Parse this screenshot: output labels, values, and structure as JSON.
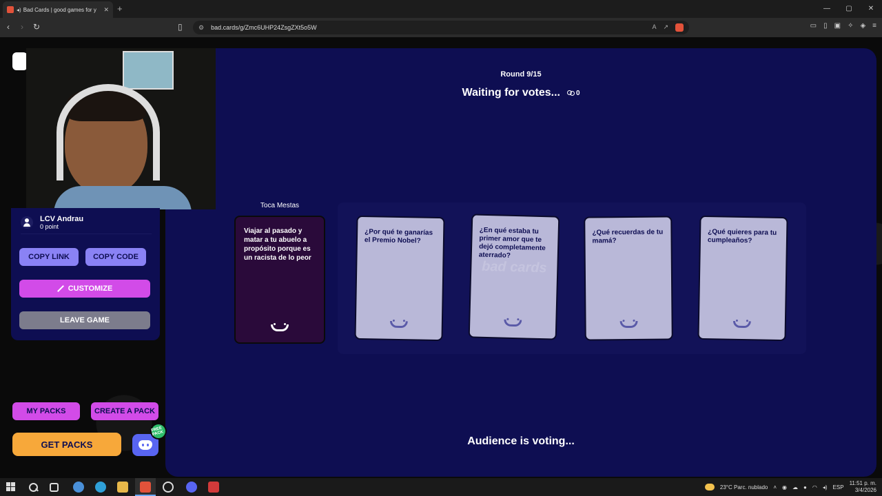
{
  "browser": {
    "tab_title": "Bad Cards | good games for y",
    "tab_close": "✕",
    "new_tab": "+",
    "url": "bad.cards/g/Zmc6UHP24ZsgZXt5o5W",
    "window_controls": [
      "—",
      "▢",
      "✕"
    ]
  },
  "game": {
    "round_label": "Round 9/15",
    "status": "Waiting for votes...",
    "vote_count": "0",
    "prompt_player": "Toca Mestas",
    "black_card_text": "Viajar al pasado y matar a tu abuelo a propósito porque es un racista de lo peor",
    "white_cards": [
      {
        "text": "¿Por qué te ganarías el Premio Nobel?"
      },
      {
        "text": "¿En qué estaba tu primer amor que te dejó completamente aterrado?"
      },
      {
        "text": "¿Qué recuerdas de tu mamá?"
      },
      {
        "text": "¿Qué quieres para tu cumpleaños?"
      }
    ],
    "watermark": "bad cards",
    "audience_status": "Audience is voting..."
  },
  "sidebar": {
    "player_name": "LCV Andrau",
    "player_points": "0 point",
    "copy_link_label": "COPY LINK",
    "copy_code_label": "COPY CODE",
    "customize_label": "CUSTOMIZE",
    "leave_label": "LEAVE GAME",
    "my_packs_label": "MY PACKS",
    "create_pack_label": "CREATE A PACK",
    "get_packs_label": "GET PACKS",
    "free_badge": "FREE PACK"
  },
  "taskbar": {
    "weather": "23°C  Parc. nublado",
    "language": "ESP",
    "time": "11:51 p. m.",
    "date": "3/4/2026"
  },
  "colors": {
    "panel": "#0e0e52",
    "white_card": "#b9b8d8",
    "black_card": "#2a0a3a",
    "copy_buttons": "#8a82f5",
    "customize": "#d24be8",
    "get_packs": "#f7a83a",
    "discord": "#5865f2"
  }
}
